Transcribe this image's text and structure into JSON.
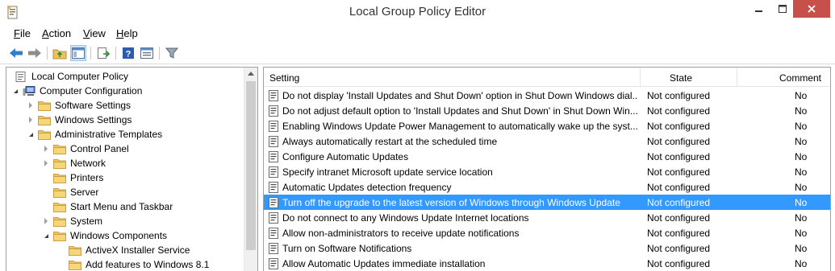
{
  "window": {
    "title": "Local Group Policy Editor"
  },
  "menu": [
    {
      "label": "File",
      "key": "F",
      "rest": "ile"
    },
    {
      "label": "Action",
      "key": "A",
      "rest": "ction"
    },
    {
      "label": "View",
      "key": "V",
      "rest": "iew"
    },
    {
      "label": "Help",
      "key": "H",
      "rest": "elp"
    }
  ],
  "toolbar": {
    "icons": [
      "back-icon",
      "forward-icon",
      "up-folder-icon",
      "show-hide-tree-icon",
      "export-list-icon",
      "help-icon",
      "properties-icon",
      "filter-icon"
    ]
  },
  "tree": {
    "items": [
      {
        "label": "Local Computer Policy",
        "icon": "policy-icon",
        "toggle": "none"
      },
      {
        "label": "Computer Configuration",
        "icon": "computer-icon",
        "toggle": "expanded"
      },
      {
        "label": "Software Settings",
        "icon": "folder-icon",
        "toggle": "collapsed"
      },
      {
        "label": "Windows Settings",
        "icon": "folder-icon",
        "toggle": "collapsed"
      },
      {
        "label": "Administrative Templates",
        "icon": "folder-icon",
        "toggle": "expanded"
      },
      {
        "label": "Control Panel",
        "icon": "folder-icon",
        "toggle": "collapsed"
      },
      {
        "label": "Network",
        "icon": "folder-icon",
        "toggle": "collapsed"
      },
      {
        "label": "Printers",
        "icon": "folder-icon",
        "toggle": "none"
      },
      {
        "label": "Server",
        "icon": "folder-icon",
        "toggle": "none"
      },
      {
        "label": "Start Menu and Taskbar",
        "icon": "folder-icon",
        "toggle": "none"
      },
      {
        "label": "System",
        "icon": "folder-icon",
        "toggle": "collapsed"
      },
      {
        "label": "Windows Components",
        "icon": "folder-icon",
        "toggle": "expanded"
      },
      {
        "label": "ActiveX Installer Service",
        "icon": "folder-icon",
        "toggle": "none"
      },
      {
        "label": "Add features to Windows 8.1",
        "icon": "folder-icon",
        "toggle": "none"
      }
    ]
  },
  "list": {
    "columns": {
      "setting": "Setting",
      "state": "State",
      "comment": "Comment"
    },
    "rows": [
      {
        "setting": "Do not display 'Install Updates and Shut Down' option in Shut Down Windows dial...",
        "state": "Not configured",
        "comment": "No",
        "selected": false
      },
      {
        "setting": "Do not adjust default option to 'Install Updates and Shut Down' in Shut Down Win...",
        "state": "Not configured",
        "comment": "No",
        "selected": false
      },
      {
        "setting": "Enabling Windows Update Power Management to automatically wake up the syst...",
        "state": "Not configured",
        "comment": "No",
        "selected": false
      },
      {
        "setting": "Always automatically restart at the scheduled time",
        "state": "Not configured",
        "comment": "No",
        "selected": false
      },
      {
        "setting": "Configure Automatic Updates",
        "state": "Not configured",
        "comment": "No",
        "selected": false
      },
      {
        "setting": "Specify intranet Microsoft update service location",
        "state": "Not configured",
        "comment": "No",
        "selected": false
      },
      {
        "setting": "Automatic Updates detection frequency",
        "state": "Not configured",
        "comment": "No",
        "selected": false
      },
      {
        "setting": "Turn off the upgrade to the latest version of Windows through Windows Update",
        "state": "Not configured",
        "comment": "No",
        "selected": true
      },
      {
        "setting": "Do not connect to any Windows Update Internet locations",
        "state": "Not configured",
        "comment": "No",
        "selected": false
      },
      {
        "setting": "Allow non-administrators to receive update notifications",
        "state": "Not configured",
        "comment": "No",
        "selected": false
      },
      {
        "setting": "Turn on Software Notifications",
        "state": "Not configured",
        "comment": "No",
        "selected": false
      },
      {
        "setting": "Allow Automatic Updates immediate installation",
        "state": "Not configured",
        "comment": "No",
        "selected": false
      }
    ]
  },
  "colors": {
    "selection": "#3399ff",
    "close_button": "#c7504a",
    "folder": "#f0c75e"
  }
}
